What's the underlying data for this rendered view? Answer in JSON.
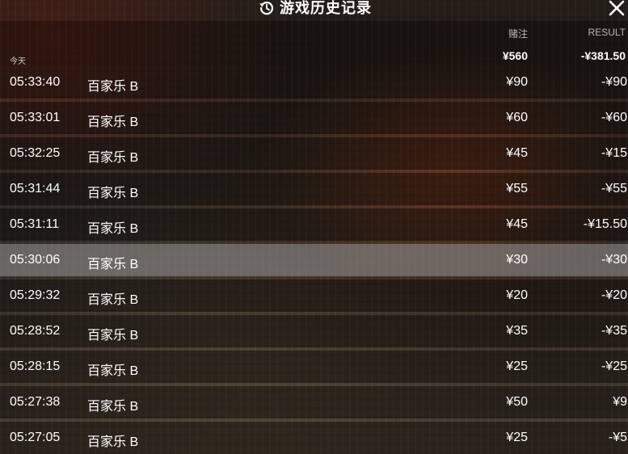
{
  "header": {
    "title": "游戏历史记录",
    "history_icon": "history-icon",
    "close_icon": "close-icon"
  },
  "columns": {
    "stake": "赌注",
    "result": "RESULT"
  },
  "summary": {
    "day_label": "今天",
    "total_stake": "¥560",
    "total_result": "-¥381.50"
  },
  "rows": [
    {
      "time": "05:33:40",
      "game": "百家乐 B",
      "stake": "¥90",
      "result": "-¥90"
    },
    {
      "time": "05:33:01",
      "game": "百家乐 B",
      "stake": "¥60",
      "result": "-¥60"
    },
    {
      "time": "05:32:25",
      "game": "百家乐 B",
      "stake": "¥45",
      "result": "-¥15"
    },
    {
      "time": "05:31:44",
      "game": "百家乐 B",
      "stake": "¥55",
      "result": "-¥55"
    },
    {
      "time": "05:31:11",
      "game": "百家乐 B",
      "stake": "¥45",
      "result": "-¥15.50"
    },
    {
      "time": "05:30:06",
      "game": "百家乐 B",
      "stake": "¥30",
      "result": "-¥30"
    },
    {
      "time": "05:29:32",
      "game": "百家乐 B",
      "stake": "¥20",
      "result": "-¥20"
    },
    {
      "time": "05:28:52",
      "game": "百家乐 B",
      "stake": "¥35",
      "result": "-¥35"
    },
    {
      "time": "05:28:15",
      "game": "百家乐 B",
      "stake": "¥25",
      "result": "-¥25"
    },
    {
      "time": "05:27:38",
      "game": "百家乐 B",
      "stake": "¥50",
      "result": "¥9"
    },
    {
      "time": "05:27:05",
      "game": "百家乐 B",
      "stake": "¥25",
      "result": "-¥5"
    }
  ],
  "colors": {
    "text": "#ffffff",
    "column_header": "#b8b8b8",
    "selected_row": "#8c8c8c"
  }
}
